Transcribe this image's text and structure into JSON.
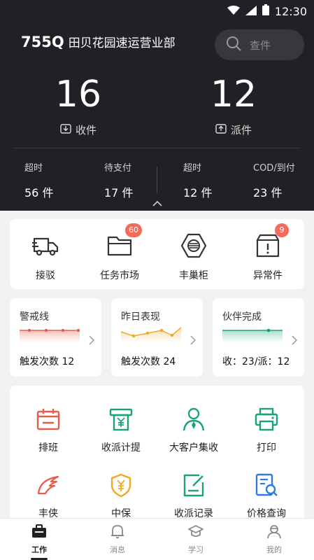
{
  "status_bar": {
    "time": "12:30"
  },
  "header": {
    "branch_code": "755Q",
    "branch_name": "田贝花园速运营业部",
    "search_placeholder": "查件",
    "received": {
      "count": "16",
      "label": "收件"
    },
    "dispatched": {
      "count": "12",
      "label": "派件"
    },
    "sub_stats": [
      {
        "label": "超时",
        "value": "56 件"
      },
      {
        "label": "待支付",
        "value": "17 件"
      },
      {
        "label": "超时",
        "value": "12 件"
      },
      {
        "label": "COD/到付",
        "value": "23 件"
      }
    ]
  },
  "quick_actions": [
    {
      "label": "接驳",
      "icon": "truck-icon",
      "badge": ""
    },
    {
      "label": "任务市场",
      "icon": "folder-icon",
      "badge": "60"
    },
    {
      "label": "丰巢柜",
      "icon": "locker-icon",
      "badge": ""
    },
    {
      "label": "异常件",
      "icon": "exception-box-icon",
      "badge": "9"
    }
  ],
  "metrics": [
    {
      "title": "警戒线",
      "value": "触发次数 12",
      "color": "#e85d4a"
    },
    {
      "title": "昨日表现",
      "value": "触发次数 24",
      "color": "#f5a623"
    },
    {
      "title": "伙伴完成",
      "value": "收：23/派：12",
      "color": "#1aa37a"
    }
  ],
  "tools": [
    {
      "label": "排班",
      "icon": "calendar-icon",
      "color": "#e85d4a"
    },
    {
      "label": "收派计提",
      "icon": "yuan-machine-icon",
      "color": "#1aa37a"
    },
    {
      "label": "大客户集收",
      "icon": "vip-person-icon",
      "color": "#1aa37a"
    },
    {
      "label": "打印",
      "icon": "printer-icon",
      "color": "#1aa37a"
    },
    {
      "label": "丰侠",
      "icon": "wing-icon",
      "color": "#e85d4a"
    },
    {
      "label": "中保",
      "icon": "insurance-shield-icon",
      "color": "#f5a623"
    },
    {
      "label": "收派记录",
      "icon": "record-edit-icon",
      "color": "#1aa37a"
    },
    {
      "label": "价格查询",
      "icon": "price-search-icon",
      "color": "#2f7be0"
    }
  ],
  "bottom_nav": [
    {
      "label": "工作",
      "icon": "work-icon",
      "active": true
    },
    {
      "label": "消息",
      "icon": "bell-icon",
      "active": false
    },
    {
      "label": "学习",
      "icon": "study-icon",
      "active": false
    },
    {
      "label": "我的",
      "icon": "profile-icon",
      "active": false
    }
  ]
}
